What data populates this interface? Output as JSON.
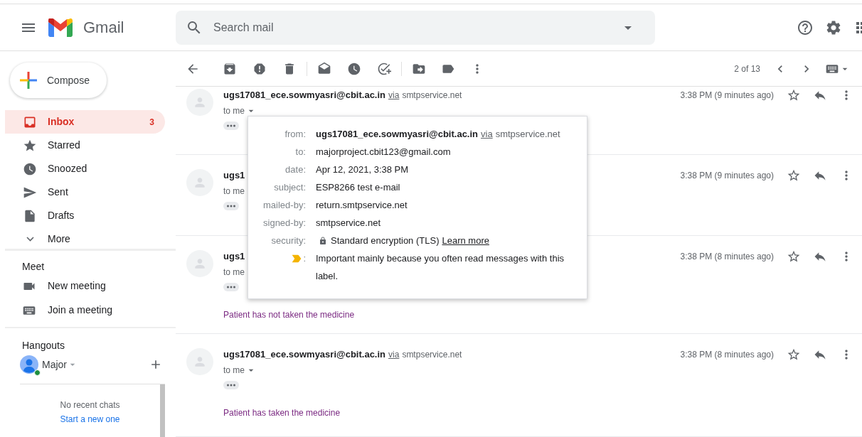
{
  "header": {
    "app_name": "Gmail",
    "search": {
      "placeholder": "Search mail"
    }
  },
  "compose": {
    "label": "Compose"
  },
  "sidebar": {
    "items": [
      {
        "label": "Inbox",
        "kind": "inbox",
        "count": "3",
        "selected": true
      },
      {
        "label": "Starred",
        "kind": "star",
        "selected": false
      },
      {
        "label": "Snoozed",
        "kind": "clock",
        "selected": false
      },
      {
        "label": "Sent",
        "kind": "send",
        "selected": false
      },
      {
        "label": "Drafts",
        "kind": "file",
        "selected": false
      },
      {
        "label": "More",
        "kind": "more",
        "selected": false
      }
    ]
  },
  "meet": {
    "title": "Meet",
    "items": [
      {
        "label": "New meeting",
        "kind": "video"
      },
      {
        "label": "Join a meeting",
        "kind": "keyboard"
      }
    ]
  },
  "hangouts": {
    "title": "Hangouts",
    "user": "Major",
    "online": true,
    "empty_text": "No recent chats",
    "link": "Start a new one"
  },
  "toolbar": {
    "pager": "2 of 13"
  },
  "messages": [
    {
      "sender": "ugs17081_ece.sowmyasri@cbit.ac.in",
      "via": "via",
      "service": "smtpservice.net",
      "to": "to me",
      "caret": true,
      "time": "3:38 PM (9 minutes ago)"
    },
    {
      "sender": "ugs1",
      "to": "to me",
      "caret": false,
      "time": "3:38 PM (9 minutes ago)"
    },
    {
      "sender": "ugs1",
      "to": "to me",
      "caret": false,
      "time": "3:38 PM (8 minutes ago)",
      "snippet": "Patient has not taken the medicine"
    },
    {
      "sender": "ugs17081_ece.sowmyasri@cbit.ac.in",
      "via": "via",
      "service": "smtpservice.net",
      "to": "to me",
      "caret": true,
      "time": "3:38 PM (8 minutes ago)",
      "snippet": "Patient has taken the medicine"
    }
  ],
  "details_popup": {
    "fields": [
      {
        "kind": "sender",
        "label": "from:",
        "value": "ugs17081_ece.sowmyasri@cbit.ac.in",
        "via": "via",
        "service": "smtpservice.net"
      },
      {
        "kind": "plain",
        "label": "to:",
        "value": "majorproject.cbit123@gmail.com"
      },
      {
        "kind": "plain",
        "label": "date:",
        "value": "Apr 12, 2021, 3:38 PM"
      },
      {
        "kind": "plain",
        "label": "subject:",
        "value": "ESP8266 test e-mail"
      },
      {
        "kind": "plain",
        "label": "mailed-by:",
        "value": "return.smtpservice.net"
      },
      {
        "kind": "plain",
        "label": "signed-by:",
        "value": "smtpservice.net"
      },
      {
        "kind": "security",
        "label": "security:",
        "value": "Standard encryption (TLS)",
        "link": "Learn more"
      },
      {
        "kind": "important",
        "label": ":",
        "value": "Important mainly because you often read messages with this label."
      }
    ]
  }
}
